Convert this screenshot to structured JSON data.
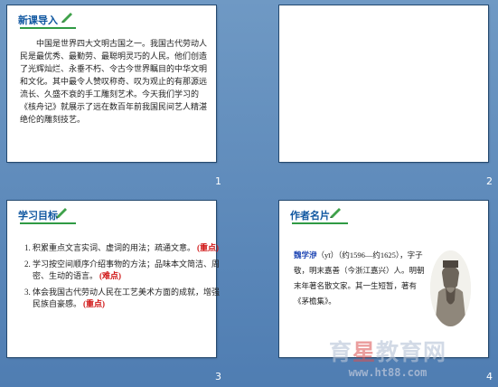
{
  "slides": [
    {
      "number": "1",
      "title": "新课导入",
      "intro": "中国是世界四大文明古国之一。我国古代劳动人民是最优秀、最勤劳、最聪明灵巧的人民。他们创造了光辉灿烂、永垂不朽、令古今世界瞩目的中华文明和文化。其中最令人赞叹称奇、叹为观止的有那源远流长、久盛不衰的手工雕刻艺术。今天我们学习的《核舟记》就展示了远在数百年前我国民间艺人精湛绝伦的雕刻技艺。",
      "title_icon": "pencil-icon"
    },
    {
      "number": "2"
    },
    {
      "number": "3",
      "title": "学习目标",
      "goals": [
        {
          "text": "积累重点文言实词、虚词的用法；疏通文意。",
          "mark": "(重点)"
        },
        {
          "text": "学习按空间顺序介绍事物的方法；品味本文简洁、周密、生动的语言。",
          "mark": "(难点)"
        },
        {
          "text": "体会我国古代劳动人民在工艺美术方面的成就，增强民族自豪感。",
          "mark": "(重点)"
        }
      ],
      "title_icon": "pencil-icon"
    },
    {
      "number": "4",
      "title": "作者名片",
      "author_name": "魏学洢",
      "author_rest": "（yī）（约1596—约1625），字子敬，明末嘉善（今浙江嘉兴）人。明朝末年著名散文家。其一生短暂，著有《茅檐集》。",
      "portrait_icon": "scholar-portrait-icon",
      "title_icon": "pencil-icon"
    }
  ],
  "watermark": {
    "prefix": "育",
    "star": "星",
    "suffix": "教育网",
    "url": "www.ht88.com"
  }
}
